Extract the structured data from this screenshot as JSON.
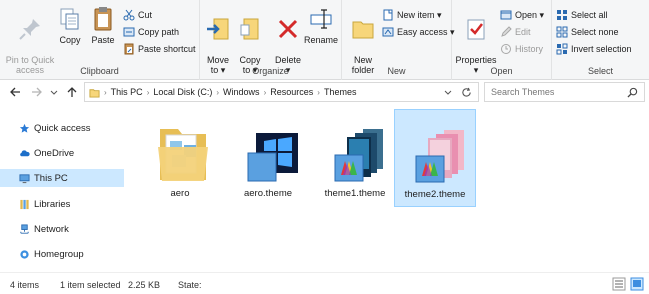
{
  "ribbon": {
    "clipboard": {
      "label": "Clipboard",
      "pin": "Pin to Quick\naccess",
      "copy": "Copy",
      "paste": "Paste",
      "cut": "Cut",
      "copy_path": "Copy path",
      "paste_shortcut": "Paste shortcut"
    },
    "organize": {
      "label": "Organize",
      "move_to": "Move\nto ▾",
      "copy_to": "Copy\nto ▾",
      "delete": "Delete\n▾",
      "rename": "Rename"
    },
    "new": {
      "label": "New",
      "new_folder": "New\nfolder",
      "new_item": "New item ▾",
      "easy_access": "Easy access ▾"
    },
    "open": {
      "label": "Open",
      "properties": "Properties\n▾",
      "open": "Open ▾",
      "edit": "Edit",
      "history": "History"
    },
    "select": {
      "label": "Select",
      "select_all": "Select all",
      "select_none": "Select none",
      "invert_selection": "Invert selection"
    }
  },
  "address": {
    "breadcrumbs": [
      "This PC",
      "Local Disk (C:)",
      "Windows",
      "Resources",
      "Themes"
    ],
    "search_placeholder": "Search Themes"
  },
  "navpane": {
    "items": [
      {
        "label": "Quick access",
        "icon": "star-icon",
        "selected": false
      },
      {
        "label": "OneDrive",
        "icon": "cloud-icon",
        "selected": false
      },
      {
        "label": "This PC",
        "icon": "computer-icon",
        "selected": true
      },
      {
        "label": "Libraries",
        "icon": "library-icon",
        "selected": false
      },
      {
        "label": "Network",
        "icon": "network-icon",
        "selected": false
      },
      {
        "label": "Homegroup",
        "icon": "homegroup-icon",
        "selected": false
      }
    ]
  },
  "files": [
    {
      "name": "aero",
      "type": "folder",
      "selected": false
    },
    {
      "name": "aero.theme",
      "type": "theme",
      "selected": false
    },
    {
      "name": "theme1.theme",
      "type": "theme",
      "selected": false
    },
    {
      "name": "theme2.theme",
      "type": "theme",
      "selected": true
    }
  ],
  "status": {
    "item_count": "4 items",
    "selected": "1 item selected",
    "size": "2.25 KB",
    "state": "State:"
  },
  "colors": {
    "selection": "#cce8ff",
    "selection_border": "#99d1ff",
    "ribbon_bg": "#f5f6f7",
    "delete_red": "#d42a2a",
    "accent_blue": "#1e6fc9"
  }
}
